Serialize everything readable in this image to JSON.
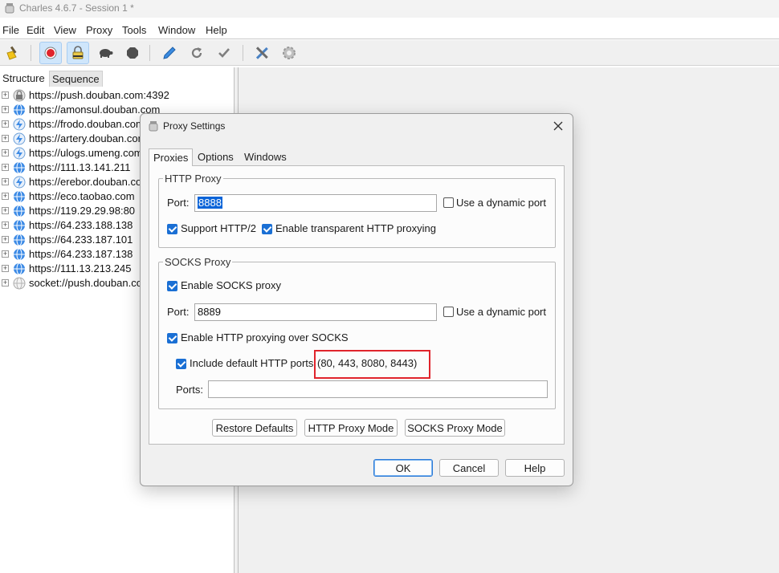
{
  "window": {
    "title": "Charles 4.6.7 - Session 1 *"
  },
  "menu": [
    "File",
    "Edit",
    "View",
    "Proxy",
    "Tools",
    "Window",
    "Help"
  ],
  "toolbar": {
    "buttons": [
      "broom-icon",
      "record-icon",
      "lock-icon",
      "turtle-icon",
      "stop-hexagon-icon",
      "pen-icon",
      "refresh-icon",
      "checkmark-icon",
      "tools-icon",
      "gear-icon"
    ],
    "colors": {
      "record": "#e0242c",
      "active_bg": "#cfe6fb"
    }
  },
  "structure": {
    "tabs": [
      "Structure",
      "Sequence"
    ],
    "hosts": [
      {
        "label": "https://push.douban.com:4392",
        "icon": "lock-globe-icon"
      },
      {
        "label": "https://amonsul.douban.com",
        "icon": "globe-icon"
      },
      {
        "label": "https://frodo.douban.com",
        "icon": "lightning-icon"
      },
      {
        "label": "https://artery.douban.com",
        "icon": "lightning-icon"
      },
      {
        "label": "https://ulogs.umeng.com",
        "icon": "lightning-icon"
      },
      {
        "label": "https://111.13.141.211",
        "icon": "globe-icon"
      },
      {
        "label": "https://erebor.douban.com",
        "icon": "lightning-icon"
      },
      {
        "label": "https://eco.taobao.com",
        "icon": "globe-icon"
      },
      {
        "label": "https://119.29.29.98:80",
        "icon": "globe-icon"
      },
      {
        "label": "https://64.233.188.138",
        "icon": "globe-icon"
      },
      {
        "label": "https://64.233.187.101",
        "icon": "globe-icon"
      },
      {
        "label": "https://64.233.187.138",
        "icon": "globe-icon"
      },
      {
        "label": "https://111.13.213.245",
        "icon": "globe-icon"
      },
      {
        "label": "socket://push.douban.com",
        "icon": "socket-globe-icon"
      }
    ]
  },
  "dialog": {
    "title": "Proxy Settings",
    "tabs": [
      "Proxies",
      "Options",
      "Windows"
    ],
    "selected_tab": "Proxies",
    "http_proxy": {
      "legend": "HTTP Proxy",
      "port_label": "Port:",
      "port_value": "8888",
      "dynamic_port_label": "Use a dynamic port",
      "dynamic_port_checked": false,
      "http2_label": "Support HTTP/2",
      "http2_checked": true,
      "transparent_label": "Enable transparent HTTP proxying",
      "transparent_checked": true
    },
    "socks_proxy": {
      "legend": "SOCKS Proxy",
      "enable_label": "Enable SOCKS proxy",
      "enable_checked": true,
      "port_label": "Port:",
      "port_value": "8889",
      "dynamic_port_label": "Use a dynamic port",
      "dynamic_port_checked": false,
      "http_over_socks_label": "Enable HTTP proxying over SOCKS",
      "http_over_socks_checked": true,
      "default_ports_label": "Include default HTTP ports",
      "default_ports_value": "(80, 443, 8080, 8443)",
      "default_ports_checked": true,
      "ports_label": "Ports:",
      "ports_value": ""
    },
    "buttons": {
      "restore": "Restore Defaults",
      "http_mode": "HTTP Proxy Mode",
      "socks_mode": "SOCKS Proxy Mode",
      "ok": "OK",
      "cancel": "Cancel",
      "help": "Help"
    },
    "annotation_color": "#e0242c"
  }
}
